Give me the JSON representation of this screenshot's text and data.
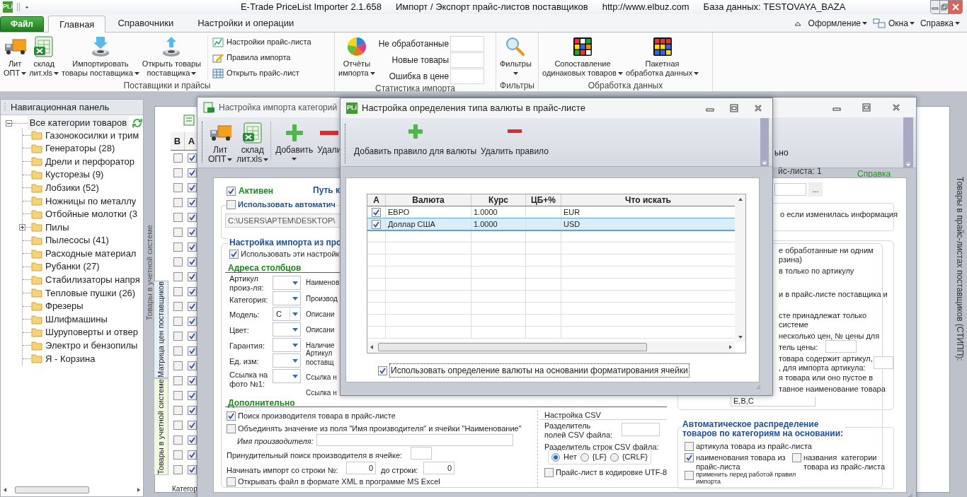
{
  "title_bar": {
    "logo": "PLi",
    "app": "E-Trade PriceList Importer 2.1.658",
    "subtitle": "Импорт / Экспорт прайс-листов поставщиков",
    "url": "http://www.elbuz.com",
    "database": "База данных: TESTOVAYA_BAZA"
  },
  "ribbon": {
    "tabs": [
      {
        "label": "Файл",
        "kind": "file",
        "selected": false
      },
      {
        "label": "Главная",
        "kind": "tab",
        "selected": true
      },
      {
        "label": "Справочники",
        "kind": "tab",
        "selected": false
      },
      {
        "label": "Настройки и операции",
        "kind": "tab",
        "selected": false
      }
    ],
    "right_menu": [
      {
        "label": "Оформление"
      },
      {
        "label": "Окна"
      },
      {
        "label": "Справка"
      }
    ],
    "groups": [
      {
        "label": "Поставщики и прайсы",
        "large_buttons": [
          {
            "label": "Лит\nОПТ"
          },
          {
            "label": "склад\nлит.xls"
          },
          {
            "label": "Импортировать\nтовары поставщика"
          },
          {
            "label": "Открыть товары\nпоставщика"
          }
        ],
        "small_buttons": [
          {
            "label": "Настройки прайс-листа"
          },
          {
            "label": "Правила импорта"
          },
          {
            "label": "Открыть прайс-лист"
          }
        ]
      },
      {
        "label": "Статистика импорта",
        "large_buttons": [
          {
            "label": "Отчёты\nимпорта"
          }
        ],
        "stats": [
          {
            "label": "Не обработанные"
          },
          {
            "label": "Новые товары"
          },
          {
            "label": "Ошибка в цене"
          }
        ]
      },
      {
        "label": "Фильтры",
        "large_buttons": [
          {
            "label": "Фильтры"
          }
        ]
      },
      {
        "label": "Обработка данных",
        "large_buttons": [
          {
            "label": "Сопоставление\nодинаковых товаров"
          },
          {
            "label": "Пакетная\nобработка данных"
          }
        ]
      }
    ]
  },
  "nav_panel": {
    "title": "Навигационная панель",
    "tree": {
      "label": "Все категории товаров",
      "expanded": true,
      "children": [
        {
          "label": "Газонокосилки и трим",
          "expandable": false
        },
        {
          "label": "Генераторы (28)",
          "expandable": false
        },
        {
          "label": "Дрели и перфоратор",
          "expandable": false
        },
        {
          "label": "Кусторезы (9)",
          "expandable": false
        },
        {
          "label": "Лобзики (52)",
          "expandable": false
        },
        {
          "label": "Ножницы по металлу",
          "expandable": false
        },
        {
          "label": "Отбойные молотки (3",
          "expandable": false
        },
        {
          "label": "Пилы",
          "expandable": true
        },
        {
          "label": "Пылесосы (41)",
          "expandable": false
        },
        {
          "label": "Расходные материал",
          "expandable": false
        },
        {
          "label": "Рубанки (27)",
          "expandable": false
        },
        {
          "label": "Стабилизаторы напря",
          "expandable": false
        },
        {
          "label": "Тепловые пушки (26)",
          "expandable": false
        },
        {
          "label": "Фрезеры",
          "expandable": false
        },
        {
          "label": "Шлифмашины",
          "expandable": false
        },
        {
          "label": "Шуруповерты и отвер",
          "expandable": false
        },
        {
          "label": "Электро и бензопилы",
          "expandable": false
        },
        {
          "label": "Я - Корзина",
          "expandable": false
        }
      ]
    }
  },
  "back_window": {
    "side_label": "Товары в учетной системе",
    "columns": [
      "В",
      "А"
    ],
    "rows": [
      {
        "col_b": false,
        "col_a": true
      },
      {
        "col_b": false,
        "col_a": true
      },
      {
        "col_b": false,
        "col_a": true
      },
      {
        "col_b": false,
        "col_a": true
      },
      {
        "col_b": false,
        "col_a": true
      },
      {
        "col_b": false,
        "col_a": true
      },
      {
        "col_b": false,
        "col_a": true
      },
      {
        "col_b": false,
        "col_a": true
      },
      {
        "col_b": false,
        "col_a": true
      },
      {
        "col_b": false,
        "col_a": true
      },
      {
        "col_b": false,
        "col_a": true
      },
      {
        "col_b": false,
        "col_a": true
      },
      {
        "col_b": false,
        "col_a": true
      },
      {
        "col_b": false,
        "col_a": true
      },
      {
        "col_b": false,
        "col_a": true
      },
      {
        "col_b": false,
        "col_a": true
      },
      {
        "col_b": false,
        "col_a": true
      },
      {
        "col_b": false,
        "col_a": true
      },
      {
        "col_b": false,
        "col_a": true
      },
      {
        "col_b": false,
        "col_a": true
      },
      {
        "col_b": false,
        "col_a": true
      },
      {
        "col_b": false,
        "col_a": true
      }
    ],
    "footer": "Категор"
  },
  "vertical_tabs": [
    {
      "label": "Матрица цен поставщиков",
      "selected": true
    },
    {
      "label": "Товары в учетной системе",
      "selected": false
    }
  ],
  "right_side_label": "Товары в прайс-листах поставщиков (СТИПП):",
  "import_window": {
    "title": "Настройка импорта категорий",
    "toolbar": [
      {
        "label": "Лит\nОПТ",
        "dropdown": true
      },
      {
        "label": "склад\nлит.xls",
        "dropdown": true
      },
      {
        "label": "Добавить",
        "dropdown": true
      },
      {
        "label": "Удали",
        "dropdown": false
      }
    ],
    "toolbar_fragment": "ьно",
    "active": {
      "label": "Активен",
      "checked": true
    },
    "path_label": "Путь к",
    "auto": {
      "label": "Использовать автоматич",
      "checked": false
    },
    "path": "C:\\USERS\\APTEM\\DESKTOP\\",
    "import_group_title": "Настройка импорта из про",
    "use_settings": {
      "label": "Использовать эти настройк",
      "checked": true
    },
    "columns_title": "Адреса столбцов",
    "column_fields": [
      {
        "label": "Артикул\nпроиз-ля:"
      },
      {
        "label": "Категория:"
      },
      {
        "label": "Модель:",
        "value": "C"
      },
      {
        "label": "Цвет:"
      },
      {
        "label": "Гарантия:"
      },
      {
        "label": "Ед. изм:"
      },
      {
        "label": "Ссылка на\nфото №1:"
      }
    ],
    "column_labels_2": [
      "Наименов",
      "Производ",
      "Описани",
      "Описани",
      "Наличие",
      "Артикул\nпоставщ",
      "Ссылка н",
      "Ссылка н"
    ],
    "extra_title": "Дополнительно",
    "extra_checks": [
      {
        "label": "Поиск производителя товара в прайс-листе",
        "checked": true
      },
      {
        "label": "Объединять значение из поля \"Имя производителя\" и ячейки \"Наименование\"",
        "checked": false
      }
    ],
    "manufacturer_name_label": "Имя производителя:",
    "forced_search_label": "Принудительный поиск производителя в ячейке:",
    "start_row_label": "Начинать импорт со строки №:",
    "start_row": "0",
    "end_row_label": "до строки:",
    "end_row": "0",
    "open_xml": {
      "label": "Открывать файл в формате XML в программе MS Excel",
      "checked": false
    },
    "csv": {
      "title": "Настройка CSV",
      "field_sep_label": "Разделитель\nполей CSV файла:",
      "row_sep_label": "Разделитель строк CSV файла:",
      "row_sep_options": [
        {
          "label": "Нет",
          "selected": true
        },
        {
          "label": "{LF}",
          "selected": false
        },
        {
          "label": "{CRLF}",
          "selected": false
        }
      ],
      "utf8": {
        "label": "Прайс-лист в кодировке UTF-8",
        "checked": false
      }
    },
    "price_list_count": "йс-листа: 1",
    "help_link": "Справка",
    "browse_button": "...",
    "changed_info": "о если изменилась информация",
    "option_lines": [
      {
        "text": "е обработанные ни одним",
        "kind": "text"
      },
      {
        "text": "рзина)",
        "kind": "text"
      },
      {
        "text": "в только по артикулу",
        "kind": "text"
      },
      {
        "text": "и в прайс-листе поставщика и",
        "kind": "text"
      },
      {
        "text": "сте принадлежат только",
        "kind": "text"
      },
      {
        "text": "системе",
        "kind": "text"
      },
      {
        "text": "несколько цен, № цены для",
        "kind": "text"
      },
      {
        "text": "тель цены:",
        "kind": "field"
      },
      {
        "text": "товара содержит артикул,",
        "kind": "text"
      },
      {
        "text": ", для импорта артикула:",
        "kind": "field"
      },
      {
        "text": "я товара или оно пустое в",
        "kind": "text"
      },
      {
        "text": "тавное наименование товара",
        "kind": "text"
      }
    ],
    "name_columns": "E,B,C",
    "auto_distribution": {
      "title": "Автоматическое распределение\nтоваров по категориям на основании:",
      "options": [
        {
          "label": "артикула товара из прайс-листа",
          "checked": false,
          "kind": "normal"
        },
        {
          "label": "наименования товара из\nпрайс-листа",
          "checked": true,
          "kind": "normal"
        },
        {
          "label": "названия  категории\nтовара из прайс-листа",
          "checked": false,
          "kind": "normal"
        },
        {
          "label": "применить перед работой правил\nимпорта",
          "checked": false,
          "kind": "small"
        }
      ]
    }
  },
  "currency_dialog": {
    "logo": "PLi",
    "title": "Настройка определения типа валюты в прайс-листе",
    "toolbar": [
      {
        "label": "Добавить правило для валюты",
        "kind": "add"
      },
      {
        "label": "Удалить правило",
        "kind": "remove"
      }
    ],
    "grid": {
      "columns": [
        "А",
        "Валюта",
        "Курс",
        "ЦБ+%",
        "Что искать"
      ],
      "rows": [
        {
          "checked": true,
          "currency": "ЕВРО",
          "rate": "1.0000",
          "search": "EUR",
          "selected": false
        },
        {
          "checked": true,
          "currency": "Доллар США",
          "rate": "1.0000",
          "search": "USD",
          "selected": true
        }
      ]
    },
    "use_formatting": {
      "label": "Использовать определение валюты на основании форматирования ячейки",
      "checked": true
    }
  }
}
